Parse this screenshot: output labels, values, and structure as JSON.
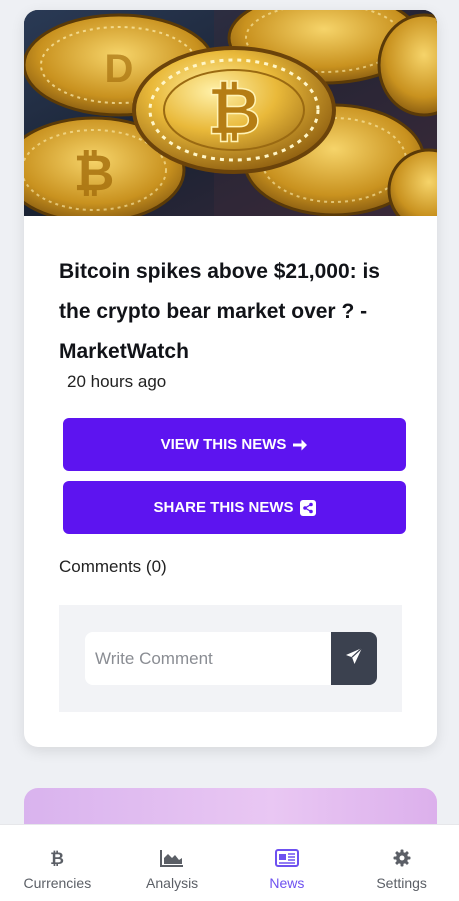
{
  "article": {
    "title": "Bitcoin spikes above $21,000: is the crypto bear market over ? - MarketWatch",
    "time_ago": "20 hours ago",
    "image_icon": "bitcoin-coins-image"
  },
  "actions": {
    "view_label": "VIEW THIS NEWS",
    "view_icon": "arrow-right-icon",
    "share_label": "SHARE THIS NEWS",
    "share_icon": "share-icon"
  },
  "comments": {
    "label": "Comments (0)",
    "input_placeholder": "Write Comment",
    "input_value": "",
    "send_icon": "paper-plane-icon"
  },
  "nav": {
    "items": [
      {
        "label": "Currencies",
        "icon": "bitcoin-icon",
        "active": false
      },
      {
        "label": "Analysis",
        "icon": "area-chart-icon",
        "active": false
      },
      {
        "label": "News",
        "icon": "newspaper-icon",
        "active": true
      },
      {
        "label": "Settings",
        "icon": "gear-icon",
        "active": false
      }
    ]
  },
  "colors": {
    "accent": "#5d14f0",
    "nav_active": "#6e51f0",
    "send_button": "#3b414f"
  }
}
